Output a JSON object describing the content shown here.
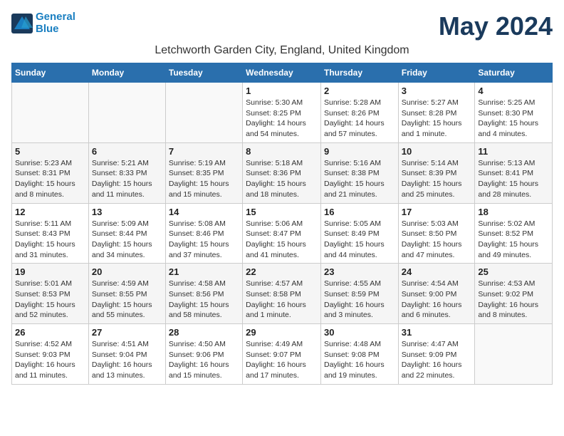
{
  "header": {
    "logo_line1": "General",
    "logo_line2": "Blue",
    "month_title": "May 2024",
    "location": "Letchworth Garden City, England, United Kingdom"
  },
  "weekdays": [
    "Sunday",
    "Monday",
    "Tuesday",
    "Wednesday",
    "Thursday",
    "Friday",
    "Saturday"
  ],
  "weeks": [
    [
      {
        "day": "",
        "info": ""
      },
      {
        "day": "",
        "info": ""
      },
      {
        "day": "",
        "info": ""
      },
      {
        "day": "1",
        "info": "Sunrise: 5:30 AM\nSunset: 8:25 PM\nDaylight: 14 hours\nand 54 minutes."
      },
      {
        "day": "2",
        "info": "Sunrise: 5:28 AM\nSunset: 8:26 PM\nDaylight: 14 hours\nand 57 minutes."
      },
      {
        "day": "3",
        "info": "Sunrise: 5:27 AM\nSunset: 8:28 PM\nDaylight: 15 hours\nand 1 minute."
      },
      {
        "day": "4",
        "info": "Sunrise: 5:25 AM\nSunset: 8:30 PM\nDaylight: 15 hours\nand 4 minutes."
      }
    ],
    [
      {
        "day": "5",
        "info": "Sunrise: 5:23 AM\nSunset: 8:31 PM\nDaylight: 15 hours\nand 8 minutes."
      },
      {
        "day": "6",
        "info": "Sunrise: 5:21 AM\nSunset: 8:33 PM\nDaylight: 15 hours\nand 11 minutes."
      },
      {
        "day": "7",
        "info": "Sunrise: 5:19 AM\nSunset: 8:35 PM\nDaylight: 15 hours\nand 15 minutes."
      },
      {
        "day": "8",
        "info": "Sunrise: 5:18 AM\nSunset: 8:36 PM\nDaylight: 15 hours\nand 18 minutes."
      },
      {
        "day": "9",
        "info": "Sunrise: 5:16 AM\nSunset: 8:38 PM\nDaylight: 15 hours\nand 21 minutes."
      },
      {
        "day": "10",
        "info": "Sunrise: 5:14 AM\nSunset: 8:39 PM\nDaylight: 15 hours\nand 25 minutes."
      },
      {
        "day": "11",
        "info": "Sunrise: 5:13 AM\nSunset: 8:41 PM\nDaylight: 15 hours\nand 28 minutes."
      }
    ],
    [
      {
        "day": "12",
        "info": "Sunrise: 5:11 AM\nSunset: 8:43 PM\nDaylight: 15 hours\nand 31 minutes."
      },
      {
        "day": "13",
        "info": "Sunrise: 5:09 AM\nSunset: 8:44 PM\nDaylight: 15 hours\nand 34 minutes."
      },
      {
        "day": "14",
        "info": "Sunrise: 5:08 AM\nSunset: 8:46 PM\nDaylight: 15 hours\nand 37 minutes."
      },
      {
        "day": "15",
        "info": "Sunrise: 5:06 AM\nSunset: 8:47 PM\nDaylight: 15 hours\nand 41 minutes."
      },
      {
        "day": "16",
        "info": "Sunrise: 5:05 AM\nSunset: 8:49 PM\nDaylight: 15 hours\nand 44 minutes."
      },
      {
        "day": "17",
        "info": "Sunrise: 5:03 AM\nSunset: 8:50 PM\nDaylight: 15 hours\nand 47 minutes."
      },
      {
        "day": "18",
        "info": "Sunrise: 5:02 AM\nSunset: 8:52 PM\nDaylight: 15 hours\nand 49 minutes."
      }
    ],
    [
      {
        "day": "19",
        "info": "Sunrise: 5:01 AM\nSunset: 8:53 PM\nDaylight: 15 hours\nand 52 minutes."
      },
      {
        "day": "20",
        "info": "Sunrise: 4:59 AM\nSunset: 8:55 PM\nDaylight: 15 hours\nand 55 minutes."
      },
      {
        "day": "21",
        "info": "Sunrise: 4:58 AM\nSunset: 8:56 PM\nDaylight: 15 hours\nand 58 minutes."
      },
      {
        "day": "22",
        "info": "Sunrise: 4:57 AM\nSunset: 8:58 PM\nDaylight: 16 hours\nand 1 minute."
      },
      {
        "day": "23",
        "info": "Sunrise: 4:55 AM\nSunset: 8:59 PM\nDaylight: 16 hours\nand 3 minutes."
      },
      {
        "day": "24",
        "info": "Sunrise: 4:54 AM\nSunset: 9:00 PM\nDaylight: 16 hours\nand 6 minutes."
      },
      {
        "day": "25",
        "info": "Sunrise: 4:53 AM\nSunset: 9:02 PM\nDaylight: 16 hours\nand 8 minutes."
      }
    ],
    [
      {
        "day": "26",
        "info": "Sunrise: 4:52 AM\nSunset: 9:03 PM\nDaylight: 16 hours\nand 11 minutes."
      },
      {
        "day": "27",
        "info": "Sunrise: 4:51 AM\nSunset: 9:04 PM\nDaylight: 16 hours\nand 13 minutes."
      },
      {
        "day": "28",
        "info": "Sunrise: 4:50 AM\nSunset: 9:06 PM\nDaylight: 16 hours\nand 15 minutes."
      },
      {
        "day": "29",
        "info": "Sunrise: 4:49 AM\nSunset: 9:07 PM\nDaylight: 16 hours\nand 17 minutes."
      },
      {
        "day": "30",
        "info": "Sunrise: 4:48 AM\nSunset: 9:08 PM\nDaylight: 16 hours\nand 19 minutes."
      },
      {
        "day": "31",
        "info": "Sunrise: 4:47 AM\nSunset: 9:09 PM\nDaylight: 16 hours\nand 22 minutes."
      },
      {
        "day": "",
        "info": ""
      }
    ]
  ]
}
